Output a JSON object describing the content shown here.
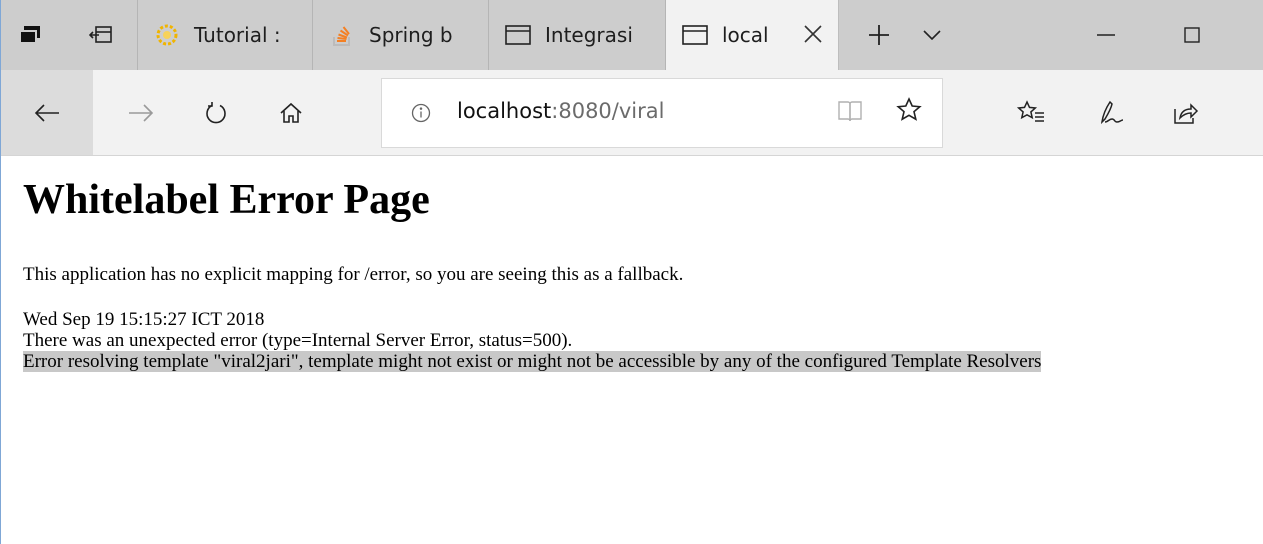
{
  "tabs": [
    {
      "label": "Tutorial :",
      "icon": "java-gear-icon",
      "active": false
    },
    {
      "label": "Spring b",
      "icon": "stackoverflow-icon",
      "active": false
    },
    {
      "label": "Integrasi",
      "icon": "page-icon",
      "active": false
    },
    {
      "label": "local",
      "icon": "page-icon",
      "active": true
    }
  ],
  "address": {
    "host": "localhost",
    "path": ":8080/viral"
  },
  "page": {
    "heading": "Whitelabel Error Page",
    "lead": "This application has no explicit mapping for /error, so you are seeing this as a fallback.",
    "timestamp": "Wed Sep 19 15:15:27 ICT 2018",
    "error_line": "There was an unexpected error (type=Internal Server Error, status=500).",
    "error_message": "Error resolving template \"viral2jari\", template might not exist or might not be accessible by any of the configured Template Resolvers"
  },
  "colors": {
    "tabbar": "#cdcdcd",
    "active_tab": "#f2f2f2",
    "highlight": "#c8c8c8",
    "java_icon": "#f0b400",
    "stackoverflow_icon": "#f48024"
  }
}
